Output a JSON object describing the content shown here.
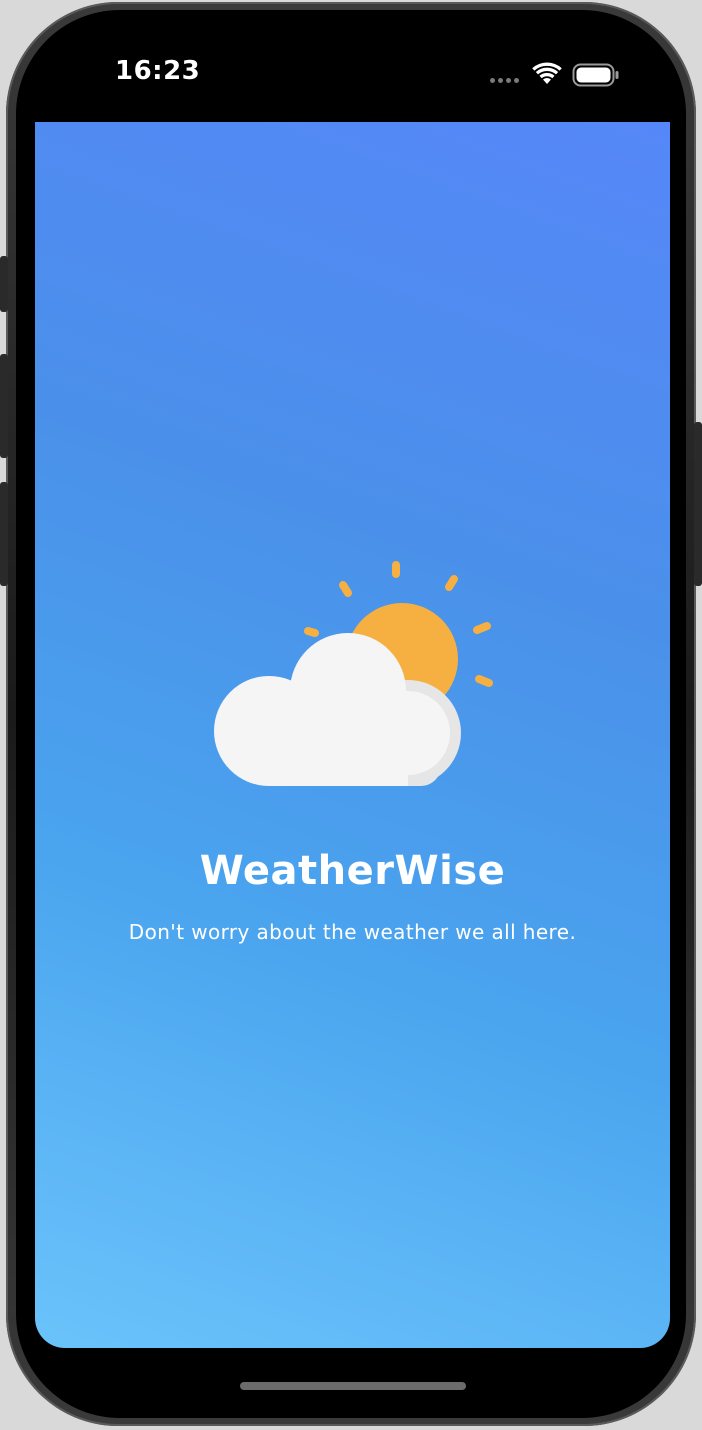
{
  "status_bar": {
    "time": "16:23"
  },
  "icons": {
    "wifi": "wifi-icon",
    "battery": "battery-icon",
    "signal": "signal-icon",
    "weather": "partly-cloudy-icon"
  },
  "splash": {
    "title": "WeatherWise",
    "tagline": "Don't worry about the weather we all here."
  },
  "colors": {
    "gradient_top": "#5687f8",
    "gradient_bottom": "#6bc3fb",
    "sun": "#f5b041",
    "cloud_front": "#f5f5f5",
    "cloud_back": "#e6e6e6",
    "text": "#ffffff"
  }
}
